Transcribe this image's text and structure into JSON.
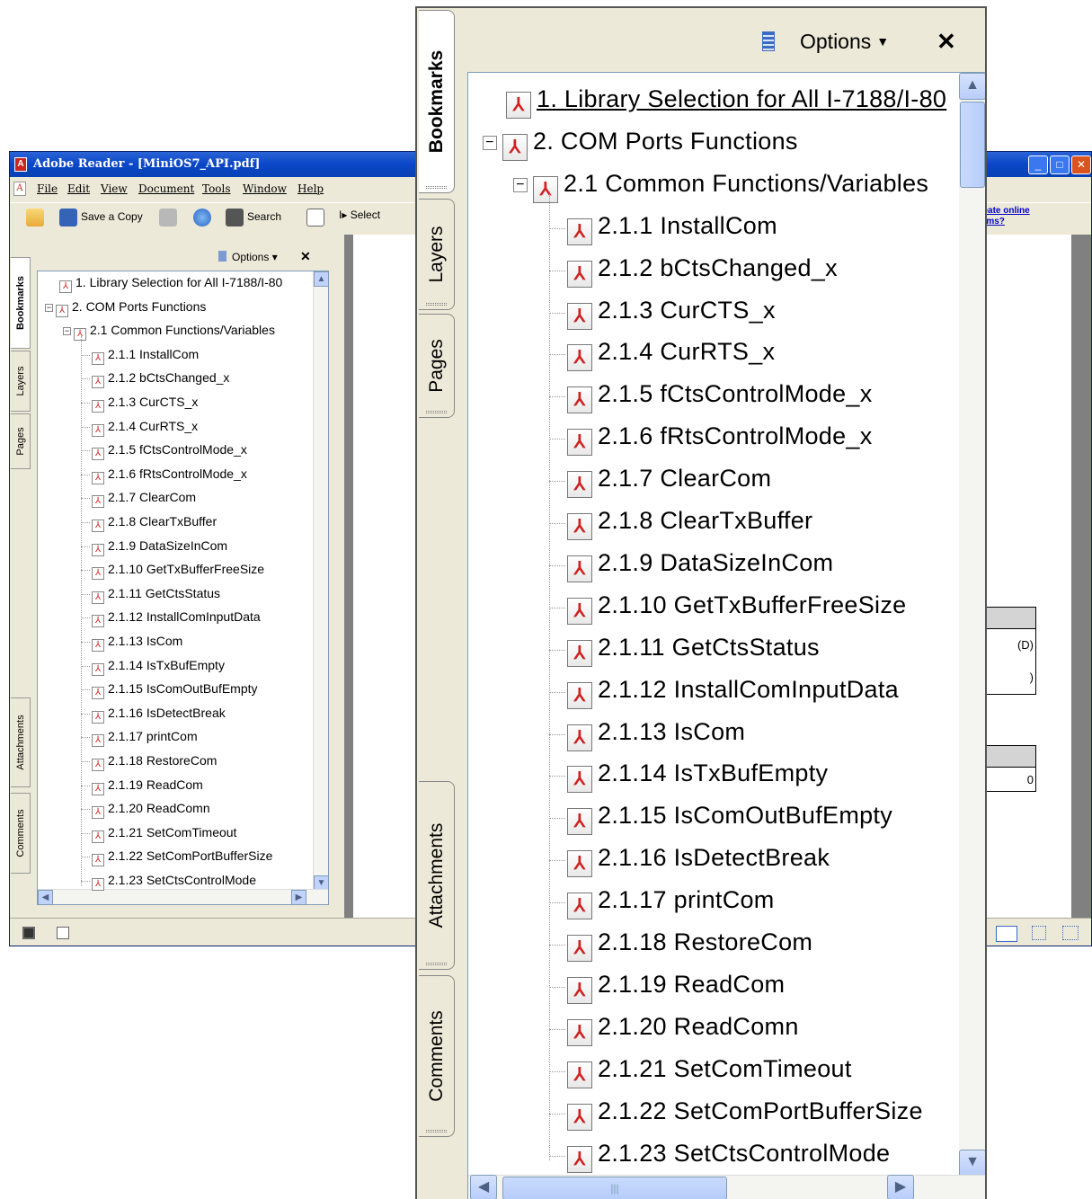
{
  "app": {
    "title": "Adobe Reader - [MiniOS7_API.pdf]",
    "window_buttons": [
      "_",
      "□",
      "✕"
    ],
    "menu": [
      "File",
      "Edit",
      "View",
      "Document",
      "Tools",
      "Window",
      "Help"
    ],
    "toolbar": {
      "save_copy": "Save a Copy",
      "search": "Search",
      "select": "Select",
      "create_link": "create online forms?"
    }
  },
  "nav_tabs": [
    "Bookmarks",
    "Layers",
    "Pages",
    "Attachments",
    "Comments"
  ],
  "bookmarks_panel": {
    "options_label": "Options",
    "close_label": "✕"
  },
  "bookmarks": [
    {
      "num": "1.",
      "text": "Library Selection for All I-7188/I-80",
      "level": 0
    },
    {
      "num": "2.",
      "text": "COM Ports Functions",
      "level": 0
    },
    {
      "num": "2.1",
      "text": "Common Functions/Variables",
      "level": 1
    },
    {
      "num": "2.1.1",
      "text": "InstallCom",
      "level": 2
    },
    {
      "num": "2.1.2",
      "text": "bCtsChanged_x",
      "level": 2
    },
    {
      "num": "2.1.3",
      "text": "CurCTS_x",
      "level": 2
    },
    {
      "num": "2.1.4",
      "text": "CurRTS_x",
      "level": 2
    },
    {
      "num": "2.1.5",
      "text": "fCtsControlMode_x",
      "level": 2
    },
    {
      "num": "2.1.6",
      "text": "fRtsControlMode_x",
      "level": 2
    },
    {
      "num": "2.1.7",
      "text": "ClearCom",
      "level": 2
    },
    {
      "num": "2.1.8",
      "text": "ClearTxBuffer",
      "level": 2
    },
    {
      "num": "2.1.9",
      "text": "DataSizeInCom",
      "level": 2
    },
    {
      "num": "2.1.10",
      "text": "GetTxBufferFreeSize",
      "level": 2
    },
    {
      "num": "2.1.11",
      "text": "GetCtsStatus",
      "level": 2
    },
    {
      "num": "2.1.12",
      "text": "InstallComInputData",
      "level": 2
    },
    {
      "num": "2.1.13",
      "text": "IsCom",
      "level": 2
    },
    {
      "num": "2.1.14",
      "text": "IsTxBufEmpty",
      "level": 2
    },
    {
      "num": "2.1.15",
      "text": "IsComOutBufEmpty",
      "level": 2
    },
    {
      "num": "2.1.16",
      "text": "IsDetectBreak",
      "level": 2
    },
    {
      "num": "2.1.17",
      "text": "printCom",
      "level": 2
    },
    {
      "num": "2.1.18",
      "text": "RestoreCom",
      "level": 2
    },
    {
      "num": "2.1.19",
      "text": "ReadCom",
      "level": 2
    },
    {
      "num": "2.1.20",
      "text": "ReadComn",
      "level": 2
    },
    {
      "num": "2.1.21",
      "text": "SetComTimeout",
      "level": 2
    },
    {
      "num": "2.1.22",
      "text": "SetComPortBufferSize",
      "level": 2
    },
    {
      "num": "2.1.23",
      "text": "SetCtsControlMode",
      "level": 2
    }
  ],
  "doc_fragments": [
    "(D)",
    ")",
    "0"
  ]
}
